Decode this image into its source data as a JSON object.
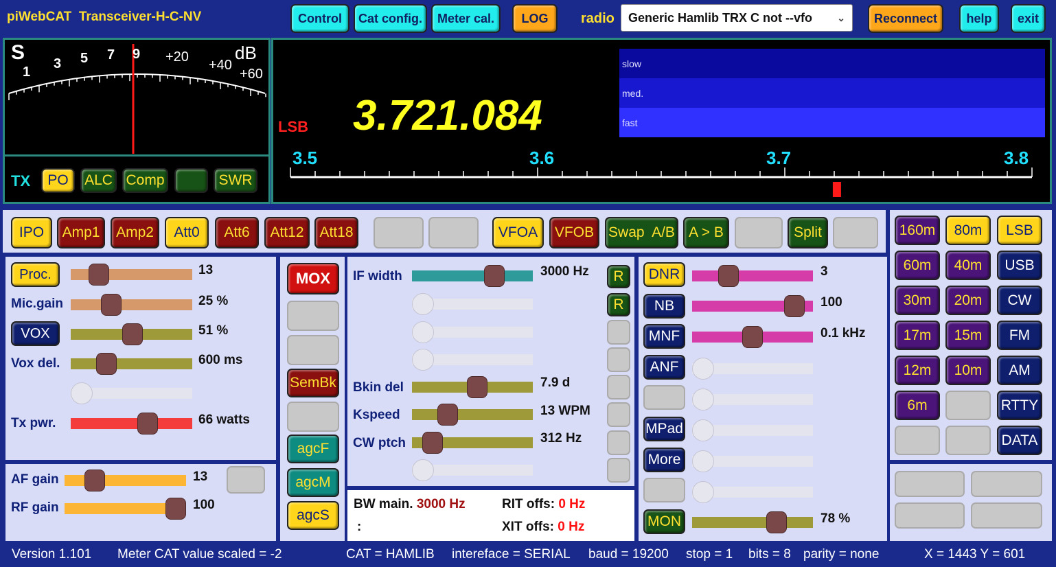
{
  "header": {
    "app": "piWebCAT",
    "transceiver": "Transceiver-H-C-NV",
    "control": "Control",
    "catconfig": "Cat config.",
    "metercal": "Meter cal.",
    "log": "LOG",
    "radio_label": "radio",
    "radio_value": "Generic Hamlib TRX C not --vfo",
    "reconnect": "Reconnect",
    "help": "help",
    "exit": "exit"
  },
  "meter": {
    "s": "S",
    "db": "dB",
    "scale": [
      "1",
      "3",
      "5",
      "7",
      "9",
      "+20",
      "+40",
      "+60"
    ],
    "tx": "TX",
    "po": "PO",
    "alc": "ALC",
    "comp": "Comp",
    "blank": "",
    "swr": "SWR"
  },
  "freq": {
    "mode": "LSB",
    "value": "3.721.084",
    "speeds": [
      "slow",
      "med.",
      "fast"
    ],
    "bandstart": "3.5",
    "b1": "3.6",
    "b2": "3.7",
    "bandend": "3.8",
    "marker": 3.721084
  },
  "row1": {
    "ipo": "IPO",
    "amp1": "Amp1",
    "amp2": "Amp2",
    "att0": "Att0",
    "att6": "Att6",
    "att12": "Att12",
    "att18": "Att18",
    "vfoa": "VFOA",
    "vfob": "VFOB",
    "swap": "Swap  A/B",
    "atob": "A > B",
    "split": "Split"
  },
  "tx": {
    "proc": "Proc.",
    "proc_val": "13",
    "proc_frac": 0.18,
    "mic": "Mic.gain",
    "mic_val": "25 %",
    "mic_frac": 0.3,
    "vox": "VOX",
    "vox_val": "51 %",
    "vox_frac": 0.51,
    "voxdel": "Vox del.",
    "voxdel_val": "600 ms",
    "voxdel_frac": 0.25,
    "txpwr": "Tx pwr.",
    "txpwr_val": "66 watts",
    "txpwr_frac": 0.66
  },
  "rx": {
    "af": "AF gain",
    "af_val": "13",
    "af_frac": 0.2,
    "rf": "RF gain",
    "rf_val": "100",
    "rf_frac": 1.0
  },
  "mid": {
    "mox": "MOX",
    "sembk": "SemBk",
    "agcf": "agcF",
    "agcm": "agcM",
    "agcs": "agcS"
  },
  "dsp": {
    "ifw": "IF width",
    "ifw_val": "3000 Hz",
    "ifw_frac": 0.72,
    "r": "R",
    "bkin": "Bkin del",
    "bkin_val": "7.9 d",
    "bkin_frac": 0.55,
    "kspeed": "Kspeed",
    "kspeed_val": "13 WPM",
    "kspeed_frac": 0.25,
    "cwp": "CW ptch",
    "cwp_val": "312 Hz",
    "cwp_frac": 0.1
  },
  "bw": {
    "bwmain": "BW main.",
    "bwmain_val": "3000 Hz",
    "colon": ":",
    "rit": "RIT offs:",
    "rit_val": "0 Hz",
    "xit": "XIT offs:",
    "xit_val": "0 Hz"
  },
  "nr": {
    "dnr": "DNR",
    "dnr_val": "3",
    "dnr_frac": 0.26,
    "nb": "NB",
    "nb_val": "100",
    "nb_frac": 0.92,
    "mnf": "MNF",
    "mnf_val": "0.1 kHz",
    "mnf_frac": 0.5,
    "anf": "ANF",
    "mpad": "MPad",
    "more": "More",
    "mon": "MON",
    "mon_val": "78 %",
    "mon_frac": 0.74
  },
  "bands": {
    "b160": "160m",
    "b80": "80m",
    "lsb": "LSB",
    "b60": "60m",
    "b40": "40m",
    "usb": "USB",
    "b30": "30m",
    "b20": "20m",
    "cw": "CW",
    "b17": "17m",
    "b15": "15m",
    "fm": "FM",
    "b12": "12m",
    "b10": "10m",
    "am": "AM",
    "b6": "6m",
    "rtty": "RTTY",
    "data": "DATA"
  },
  "status": {
    "version": "Version 1.101",
    "meter": "Meter CAT value scaled = -2",
    "cat": "CAT = HAMLIB",
    "iface": "intereface = SERIAL",
    "baud": "baud = 19200",
    "stop": "stop = 1",
    "bits": "bits = 8",
    "parity": "parity = none",
    "xy": "X = 1443 Y = 601"
  }
}
